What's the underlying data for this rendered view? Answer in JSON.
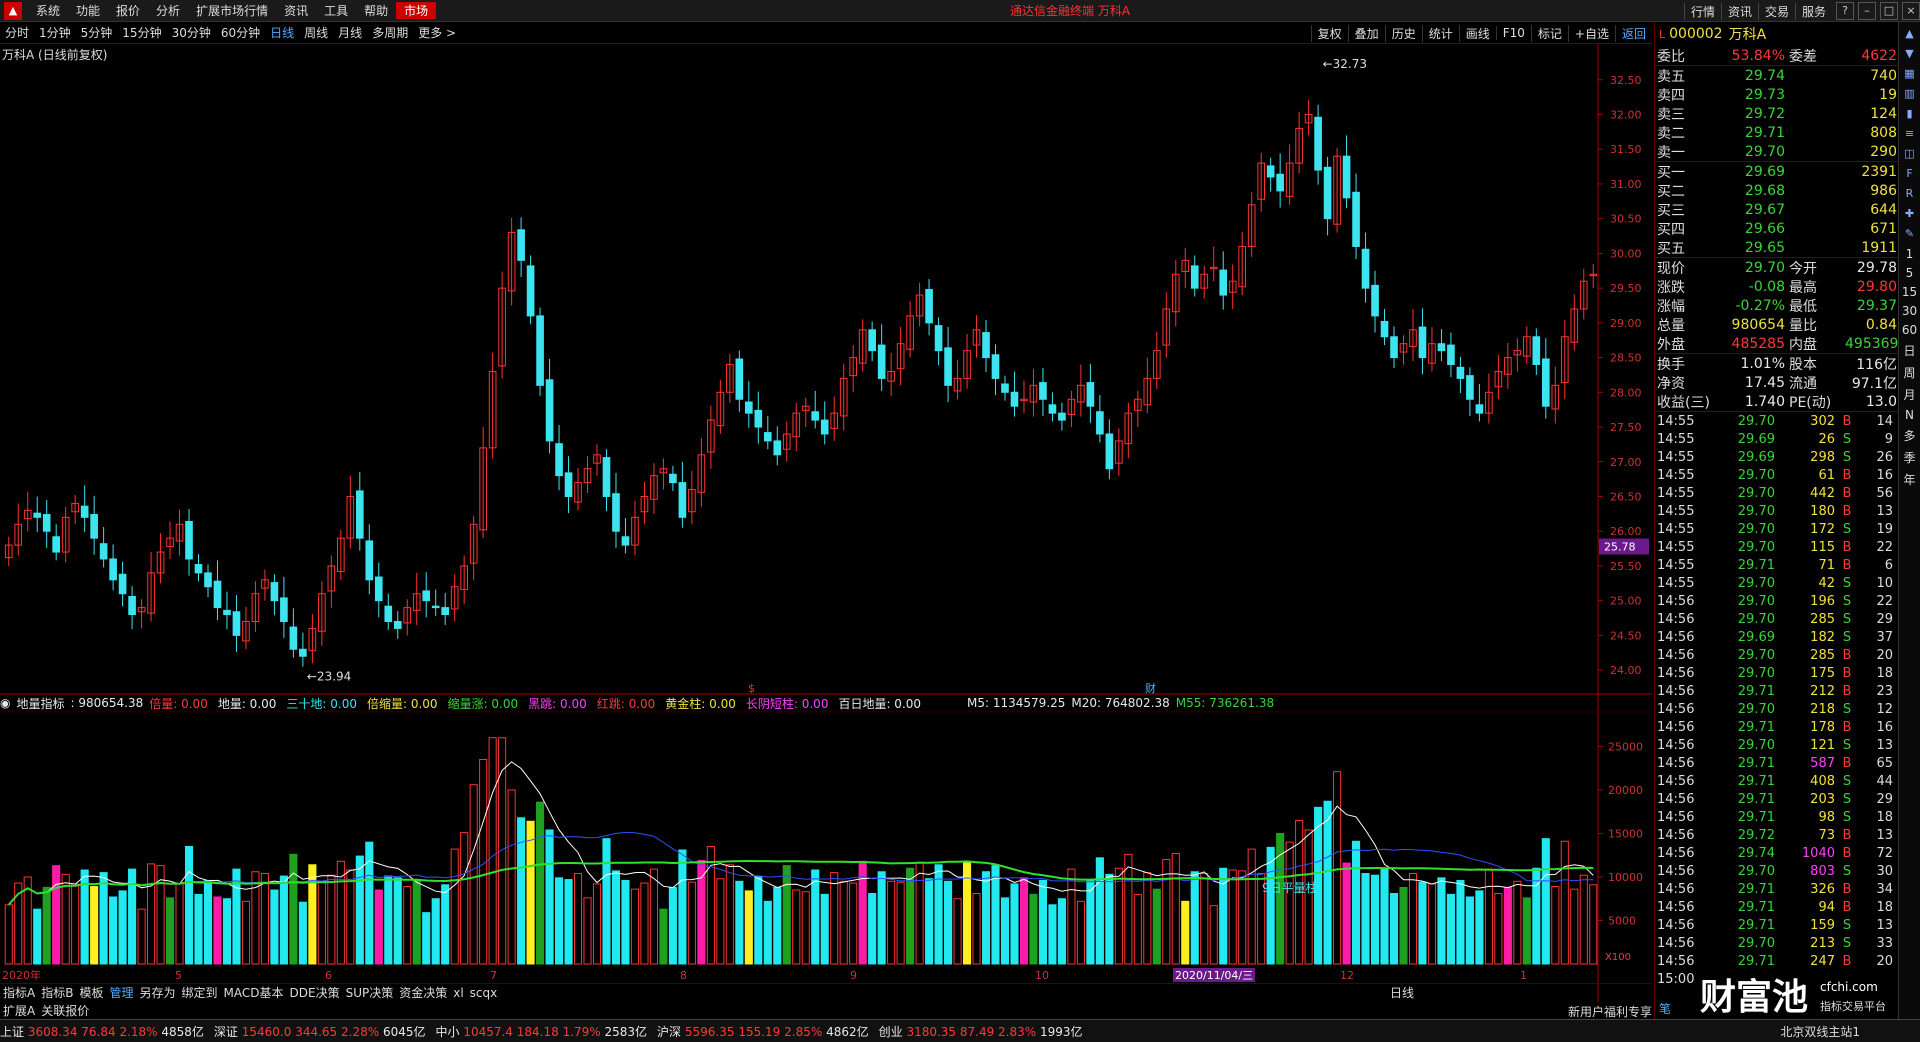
{
  "menubar": {
    "items": [
      "系统",
      "功能",
      "报价",
      "分析",
      "扩展市场行情",
      "资讯",
      "工具",
      "帮助"
    ],
    "market": "市场",
    "app_title": "通达信金融终端 万科A",
    "right": [
      "行情",
      "资讯",
      "交易",
      "服务"
    ]
  },
  "periodbar": {
    "periods": [
      "分时",
      "1分钟",
      "5分钟",
      "15分钟",
      "30分钟",
      "60分钟",
      "日线",
      "周线",
      "月线",
      "多周期",
      "更多 >"
    ],
    "active": "日线",
    "tools": [
      "复权",
      "叠加",
      "历史",
      "统计",
      "画线",
      "F10",
      "标记",
      "+自选",
      "返回"
    ]
  },
  "stock_title": "万科A (日线前复权)",
  "chart_data": {
    "type": "candlestick",
    "price_ticks": [
      "32.50",
      "32.00",
      "31.50",
      "31.00",
      "30.50",
      "30.00",
      "29.50",
      "29.00",
      "28.50",
      "28.00",
      "27.50",
      "27.00",
      "26.50",
      "26.00",
      "25.50",
      "25.00",
      "24.50",
      "24.00"
    ],
    "ylim": [
      23.8,
      32.9
    ],
    "high_label": "32.73",
    "low_label": "23.94",
    "current_tag": "25.78",
    "close": [
      25.8,
      26.1,
      26.3,
      26.2,
      26.0,
      25.7,
      26.2,
      26.4,
      26.2,
      25.9,
      25.6,
      25.3,
      25.1,
      24.8,
      24.9,
      25.4,
      25.7,
      25.9,
      26.1,
      25.6,
      25.4,
      25.2,
      24.9,
      24.8,
      24.5,
      24.7,
      25.1,
      25.3,
      25.0,
      24.7,
      24.3,
      24.2,
      24.6,
      25.1,
      25.5,
      25.9,
      26.5,
      25.9,
      25.3,
      25.0,
      24.7,
      24.6,
      24.9,
      25.1,
      25.0,
      24.9,
      24.8,
      25.2,
      25.5,
      26.1,
      27.2,
      28.3,
      29.5,
      30.3,
      29.9,
      29.1,
      28.1,
      27.3,
      26.8,
      26.5,
      26.7,
      26.9,
      27.1,
      26.5,
      26.0,
      25.8,
      26.2,
      26.5,
      26.8,
      26.9,
      26.7,
      26.2,
      26.6,
      27.1,
      27.6,
      28.0,
      28.4,
      27.9,
      27.7,
      27.5,
      27.3,
      27.1,
      27.4,
      27.7,
      27.8,
      27.6,
      27.4,
      27.7,
      28.2,
      28.5,
      28.9,
      28.6,
      28.2,
      28.3,
      28.7,
      29.1,
      29.4,
      29.0,
      28.6,
      28.1,
      28.2,
      28.6,
      28.9,
      28.5,
      28.2,
      28.0,
      27.8,
      27.9,
      28.1,
      27.9,
      27.7,
      27.6,
      27.9,
      28.1,
      27.8,
      27.4,
      26.9,
      27.3,
      27.7,
      27.9,
      28.2,
      28.6,
      29.2,
      29.7,
      29.9,
      29.5,
      29.7,
      29.8,
      29.4,
      29.6,
      30.1,
      30.7,
      31.3,
      31.1,
      30.9,
      31.3,
      31.8,
      32.0,
      31.2,
      30.5,
      31.4,
      30.8,
      30.1,
      29.5,
      29.1,
      28.8,
      28.5,
      28.7,
      28.9,
      28.5,
      28.7,
      28.6,
      28.4,
      28.2,
      27.9,
      27.7,
      28.0,
      28.3,
      28.5,
      28.6,
      28.8,
      28.4,
      27.8,
      28.1,
      28.8,
      29.2,
      29.6,
      29.7
    ],
    "volume_ticks": [
      "25000",
      "20000",
      "15000",
      "10000",
      "5000"
    ],
    "volume_max": 27000,
    "x_labels": [
      "2020年",
      "5",
      "6",
      "7",
      "8",
      "9",
      "10",
      "2020/11/04/三",
      "12",
      "1"
    ],
    "annotation": "9日平量柱",
    "markers": [
      "$",
      "财"
    ]
  },
  "volhead": {
    "name": "地量指标",
    "value": ": 980654.38",
    "items": [
      {
        "label": "倍量:",
        "val": "0.00",
        "cls": "red"
      },
      {
        "label": "地量:",
        "val": "0.00",
        "cls": "white"
      },
      {
        "label": "三十地:",
        "val": "0.00",
        "cls": "cyan"
      },
      {
        "label": "倍缩量:",
        "val": "0.00",
        "cls": "yellow"
      },
      {
        "label": "缩量涨:",
        "val": "0.00",
        "cls": "green"
      },
      {
        "label": "黑跳:",
        "val": "0.00",
        "cls": "magenta"
      },
      {
        "label": "红跳:",
        "val": "0.00",
        "cls": "red"
      },
      {
        "label": "黄金柱:",
        "val": "0.00",
        "cls": "yellow"
      },
      {
        "label": "长阴短柱:",
        "val": "0.00",
        "cls": "magenta"
      },
      {
        "label": "百日地量:",
        "val": "0.00",
        "cls": "white"
      }
    ],
    "m5": "M5: 1134579.25",
    "m20": "M20: 764802.38",
    "m55": "M55: 736261.38"
  },
  "bottomtabs": {
    "row1": [
      "指标A",
      "指标B",
      "模板",
      "管理",
      "另存为",
      "绑定到",
      "MACD基本",
      "DDE决策",
      "SUP决策",
      "资金决策",
      "xl",
      "scqx"
    ],
    "active": "管理",
    "row2": [
      "扩展A",
      "关联报价"
    ],
    "rlabel": "日线",
    "banner": "新用户福利专享",
    "x100": "X100"
  },
  "statusbar": [
    {
      "name": "上证",
      "price": "3608.34",
      "chg": "76.84",
      "pct": "2.18%",
      "amt": "4858亿"
    },
    {
      "name": "深证",
      "price": "15460.0",
      "chg": "344.65",
      "pct": "2.28%",
      "amt": "6045亿"
    },
    {
      "name": "中小",
      "price": "10457.4",
      "chg": "184.18",
      "pct": "1.79%",
      "amt": "2583亿"
    },
    {
      "name": "沪深",
      "price": "5596.35",
      "chg": "155.19",
      "pct": "2.85%",
      "amt": "4862亿"
    },
    {
      "name": "创业",
      "price": "3180.35",
      "chg": "87.49",
      "pct": "2.83%",
      "amt": "1993亿"
    }
  ],
  "status_site": "北京双线主站1",
  "rightpanel": {
    "code": "000002",
    "name": "万科A",
    "wei": {
      "l1": "委比",
      "v1": "53.84%",
      "l2": "委差",
      "v2": "4622"
    },
    "sell": [
      {
        "label": "卖五",
        "price": "29.74",
        "vol": "740"
      },
      {
        "label": "卖四",
        "price": "29.73",
        "vol": "19"
      },
      {
        "label": "卖三",
        "price": "29.72",
        "vol": "124"
      },
      {
        "label": "卖二",
        "price": "29.71",
        "vol": "808"
      },
      {
        "label": "卖一",
        "price": "29.70",
        "vol": "290"
      }
    ],
    "buy": [
      {
        "label": "买一",
        "price": "29.69",
        "vol": "2391"
      },
      {
        "label": "买二",
        "price": "29.68",
        "vol": "986"
      },
      {
        "label": "买三",
        "price": "29.67",
        "vol": "644"
      },
      {
        "label": "买四",
        "price": "29.66",
        "vol": "671"
      },
      {
        "label": "买五",
        "price": "29.65",
        "vol": "1911"
      }
    ],
    "stats": [
      {
        "l1": "现价",
        "v1": "29.70",
        "c1": "green",
        "l2": "今开",
        "v2": "29.78",
        "c2": "white"
      },
      {
        "l1": "涨跌",
        "v1": "-0.08",
        "c1": "green",
        "l2": "最高",
        "v2": "29.80",
        "c2": "red"
      },
      {
        "l1": "涨幅",
        "v1": "-0.27%",
        "c1": "green",
        "l2": "最低",
        "v2": "29.37",
        "c2": "green"
      },
      {
        "l1": "总量",
        "v1": "980654",
        "c1": "yellow",
        "l2": "量比",
        "v2": "0.84",
        "c2": "yellow"
      },
      {
        "l1": "外盘",
        "v1": "485285",
        "c1": "red",
        "l2": "内盘",
        "v2": "495369",
        "c2": "green"
      }
    ],
    "stats2": [
      {
        "l1": "换手",
        "v1": "1.01%",
        "l2": "股本",
        "v2": "116亿"
      },
      {
        "l1": "净资",
        "v1": "17.45",
        "l2": "流通",
        "v2": "97.1亿"
      },
      {
        "l1": "收益(三)",
        "v1": "1.740",
        "l2": "PE(动)",
        "v2": "13.0"
      }
    ],
    "ticks": [
      {
        "t": "14:55",
        "p": "29.70",
        "pc": "green",
        "v": "302",
        "vc": "yellow",
        "bs": "B",
        "n": "14"
      },
      {
        "t": "14:55",
        "p": "29.69",
        "pc": "green",
        "v": "26",
        "vc": "yellow",
        "bs": "S",
        "n": "9"
      },
      {
        "t": "14:55",
        "p": "29.69",
        "pc": "green",
        "v": "298",
        "vc": "yellow",
        "bs": "S",
        "n": "26"
      },
      {
        "t": "14:55",
        "p": "29.70",
        "pc": "green",
        "v": "61",
        "vc": "yellow",
        "bs": "B",
        "n": "16"
      },
      {
        "t": "14:55",
        "p": "29.70",
        "pc": "green",
        "v": "442",
        "vc": "yellow",
        "bs": "B",
        "n": "56"
      },
      {
        "t": "14:55",
        "p": "29.70",
        "pc": "green",
        "v": "180",
        "vc": "yellow",
        "bs": "B",
        "n": "13"
      },
      {
        "t": "14:55",
        "p": "29.70",
        "pc": "green",
        "v": "172",
        "vc": "yellow",
        "bs": "S",
        "n": "19"
      },
      {
        "t": "14:55",
        "p": "29.70",
        "pc": "green",
        "v": "115",
        "vc": "yellow",
        "bs": "B",
        "n": "22"
      },
      {
        "t": "14:55",
        "p": "29.71",
        "pc": "green",
        "v": "71",
        "vc": "yellow",
        "bs": "B",
        "n": "6"
      },
      {
        "t": "14:55",
        "p": "29.70",
        "pc": "green",
        "v": "42",
        "vc": "yellow",
        "bs": "S",
        "n": "10"
      },
      {
        "t": "14:56",
        "p": "29.70",
        "pc": "green",
        "v": "196",
        "vc": "yellow",
        "bs": "S",
        "n": "22"
      },
      {
        "t": "14:56",
        "p": "29.70",
        "pc": "green",
        "v": "285",
        "vc": "yellow",
        "bs": "S",
        "n": "29"
      },
      {
        "t": "14:56",
        "p": "29.69",
        "pc": "green",
        "v": "182",
        "vc": "yellow",
        "bs": "S",
        "n": "37"
      },
      {
        "t": "14:56",
        "p": "29.70",
        "pc": "green",
        "v": "285",
        "vc": "yellow",
        "bs": "B",
        "n": "20"
      },
      {
        "t": "14:56",
        "p": "29.70",
        "pc": "green",
        "v": "175",
        "vc": "yellow",
        "bs": "B",
        "n": "18"
      },
      {
        "t": "14:56",
        "p": "29.71",
        "pc": "green",
        "v": "212",
        "vc": "yellow",
        "bs": "B",
        "n": "23"
      },
      {
        "t": "14:56",
        "p": "29.70",
        "pc": "green",
        "v": "218",
        "vc": "yellow",
        "bs": "S",
        "n": "12"
      },
      {
        "t": "14:56",
        "p": "29.71",
        "pc": "green",
        "v": "178",
        "vc": "yellow",
        "bs": "B",
        "n": "16"
      },
      {
        "t": "14:56",
        "p": "29.70",
        "pc": "green",
        "v": "121",
        "vc": "yellow",
        "bs": "S",
        "n": "13"
      },
      {
        "t": "14:56",
        "p": "29.71",
        "pc": "green",
        "v": "587",
        "vc": "magenta",
        "bs": "B",
        "n": "65"
      },
      {
        "t": "14:56",
        "p": "29.71",
        "pc": "green",
        "v": "408",
        "vc": "yellow",
        "bs": "S",
        "n": "44"
      },
      {
        "t": "14:56",
        "p": "29.71",
        "pc": "green",
        "v": "203",
        "vc": "yellow",
        "bs": "S",
        "n": "29"
      },
      {
        "t": "14:56",
        "p": "29.71",
        "pc": "green",
        "v": "98",
        "vc": "yellow",
        "bs": "S",
        "n": "18"
      },
      {
        "t": "14:56",
        "p": "29.72",
        "pc": "green",
        "v": "73",
        "vc": "yellow",
        "bs": "B",
        "n": "13"
      },
      {
        "t": "14:56",
        "p": "29.74",
        "pc": "green",
        "v": "1040",
        "vc": "magenta",
        "bs": "B",
        "n": "72"
      },
      {
        "t": "14:56",
        "p": "29.70",
        "pc": "green",
        "v": "803",
        "vc": "magenta",
        "bs": "S",
        "n": "30"
      },
      {
        "t": "14:56",
        "p": "29.71",
        "pc": "green",
        "v": "326",
        "vc": "yellow",
        "bs": "B",
        "n": "34"
      },
      {
        "t": "14:56",
        "p": "29.71",
        "pc": "green",
        "v": "94",
        "vc": "yellow",
        "bs": "B",
        "n": "18"
      },
      {
        "t": "14:56",
        "p": "29.71",
        "pc": "green",
        "v": "159",
        "vc": "yellow",
        "bs": "S",
        "n": "13"
      },
      {
        "t": "14:56",
        "p": "29.70",
        "pc": "green",
        "v": "213",
        "vc": "yellow",
        "bs": "S",
        "n": "33"
      },
      {
        "t": "14:56",
        "p": "29.71",
        "pc": "green",
        "v": "247",
        "vc": "yellow",
        "bs": "B",
        "n": "20"
      },
      {
        "t": "15:00",
        "p": "",
        "pc": "green",
        "v": "",
        "vc": "yellow",
        "bs": "",
        "n": ""
      }
    ],
    "ticks_footer": "笔"
  },
  "rightbar": [
    "1",
    "5",
    "15",
    "30",
    "60",
    "日",
    "周",
    "月",
    "N",
    "多",
    "季",
    "年"
  ],
  "watermark": {
    "title": "财富池",
    "url": "cfchi.com",
    "sub": "指标交易平台"
  }
}
